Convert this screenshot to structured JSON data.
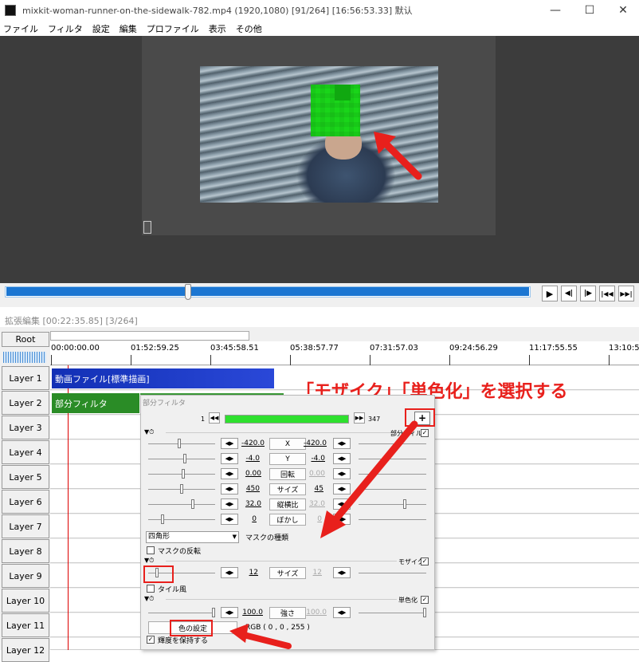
{
  "window": {
    "title": "mixkit-woman-runner-on-the-sidewalk-782.mp4 (1920,1080)  [91/264]  [16:56:53.33]  默认",
    "minimize": "—",
    "maximize": "☐",
    "close": "✕"
  },
  "menu": [
    "ファイル",
    "フィルタ",
    "設定",
    "編集",
    "プロファイル",
    "表示",
    "その他"
  ],
  "playback": {
    "play": "▶",
    "prev_frame": "◀|",
    "next_frame": "|▶",
    "go_start": "|◀◀",
    "go_end": "▶▶|"
  },
  "extended_edit": {
    "title": "拡張編集 [00:22:35.85] [3/264]"
  },
  "timeline": {
    "root_label": "Root",
    "ruler": [
      "00:00:00.00",
      "01:52:59.25",
      "03:45:58.51",
      "05:38:57.77",
      "07:31:57.03",
      "09:24:56.29",
      "11:17:55.55",
      "13:10:5"
    ],
    "layers": [
      "Layer 1",
      "Layer 2",
      "Layer 3",
      "Layer 4",
      "Layer 5",
      "Layer 6",
      "Layer 7",
      "Layer 8",
      "Layer 9",
      "Layer 10",
      "Layer 11",
      "Layer 12"
    ],
    "clips": {
      "clip1": "動画ファイル[標準描画]",
      "clip2": "部分フィルタ"
    }
  },
  "annotation": {
    "text": "「モザイク」「単色化」を選択する"
  },
  "dialog": {
    "title": "部分フィルタ",
    "frame_start": "1",
    "frame_end": "347",
    "add_button": "+",
    "section_partial": "部分フィルタ",
    "rows": [
      {
        "left_value": "-420.0",
        "button": "X",
        "right_value": "-420.0",
        "right_dim": false
      },
      {
        "left_value": "-4.0",
        "button": "Y",
        "right_value": "-4.0",
        "right_dim": false
      },
      {
        "left_value": "0.00",
        "button": "回転",
        "right_value": "0.00",
        "right_dim": true
      },
      {
        "left_value": "450",
        "button": "サイズ",
        "right_value": "45",
        "right_dim": false
      },
      {
        "left_value": "32.0",
        "button": "縦横比",
        "right_value": "32.0",
        "right_dim": true
      },
      {
        "left_value": "0",
        "button": "ぼかし",
        "right_value": "0",
        "right_dim": true
      }
    ],
    "mask_type_value": "四角形",
    "mask_type_label": "マスクの種類",
    "mask_invert_label": "マスクの反転",
    "mosaic_section": "モザイク",
    "mosaic_row": {
      "left_value": "12",
      "button": "サイズ",
      "right_value": "12"
    },
    "tile_label": "タイル風",
    "mono_section": "単色化",
    "mono_row": {
      "left_value": "100.0",
      "button": "強さ",
      "right_value": "100.0"
    },
    "color_button": "色の設定",
    "rgb_text": "RGB ( 0 , 0 , 255 )",
    "keep_luma_label": "輝度を保持する"
  },
  "colors": {
    "annotation_red": "#e8201c",
    "mosaic_green": "#19d519",
    "clip_blue": "#1230b5",
    "clip_green": "#2a8c26",
    "seek_blue": "#1b76d2"
  }
}
